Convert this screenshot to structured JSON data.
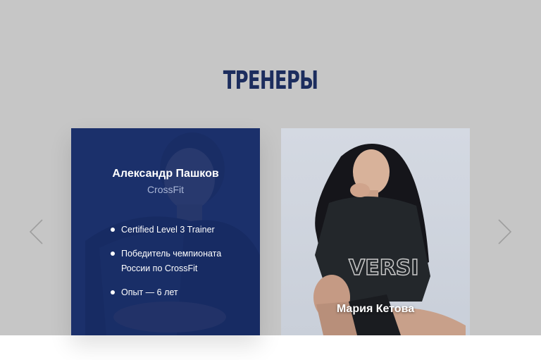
{
  "section": {
    "title": "ТРЕНЕРЫ",
    "background_color": "#c6c6c6",
    "title_color": "#1c2d5e"
  },
  "carousel": {
    "prev_icon": "chevron-left-icon",
    "next_icon": "chevron-right-icon"
  },
  "trainers": [
    {
      "name": "Александр Пашков",
      "sport": "CrossFit",
      "overlay_color": "#1c3368",
      "achievements": [
        "Certified Level 3 Trainer",
        "Победитель чемпионата России по CrossFit",
        "Опыт — 6 лет"
      ]
    },
    {
      "name": "Мария Кетова"
    }
  ]
}
